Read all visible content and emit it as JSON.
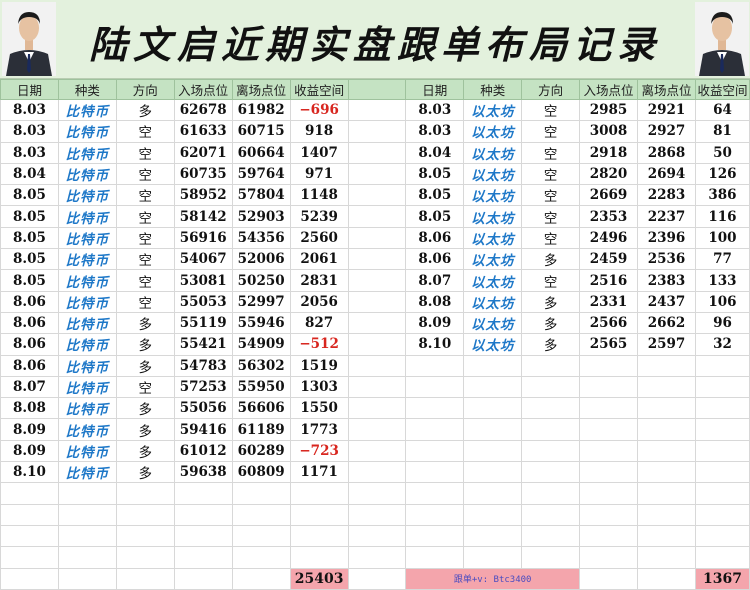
{
  "title": "陆文启近期实盘跟单布局记录",
  "headers": [
    "日期",
    "种类",
    "方向",
    "入场点位",
    "离场点位",
    "收益空间"
  ],
  "left_rows": [
    {
      "date": "8.03",
      "type": "比特币",
      "dir": "多",
      "entry": "62678",
      "exit": "61982",
      "profit": "−696",
      "neg": true
    },
    {
      "date": "8.03",
      "type": "比特币",
      "dir": "空",
      "entry": "61633",
      "exit": "60715",
      "profit": "918"
    },
    {
      "date": "8.03",
      "type": "比特币",
      "dir": "空",
      "entry": "62071",
      "exit": "60664",
      "profit": "1407"
    },
    {
      "date": "8.04",
      "type": "比特币",
      "dir": "空",
      "entry": "60735",
      "exit": "59764",
      "profit": "971"
    },
    {
      "date": "8.05",
      "type": "比特币",
      "dir": "空",
      "entry": "58952",
      "exit": "57804",
      "profit": "1148"
    },
    {
      "date": "8.05",
      "type": "比特币",
      "dir": "空",
      "entry": "58142",
      "exit": "52903",
      "profit": "5239"
    },
    {
      "date": "8.05",
      "type": "比特币",
      "dir": "空",
      "entry": "56916",
      "exit": "54356",
      "profit": "2560"
    },
    {
      "date": "8.05",
      "type": "比特币",
      "dir": "空",
      "entry": "54067",
      "exit": "52006",
      "profit": "2061"
    },
    {
      "date": "8.05",
      "type": "比特币",
      "dir": "空",
      "entry": "53081",
      "exit": "50250",
      "profit": "2831"
    },
    {
      "date": "8.06",
      "type": "比特币",
      "dir": "空",
      "entry": "55053",
      "exit": "52997",
      "profit": "2056"
    },
    {
      "date": "8.06",
      "type": "比特币",
      "dir": "多",
      "entry": "55119",
      "exit": "55946",
      "profit": "827"
    },
    {
      "date": "8.06",
      "type": "比特币",
      "dir": "多",
      "entry": "55421",
      "exit": "54909",
      "profit": "−512",
      "neg": true
    },
    {
      "date": "8.06",
      "type": "比特币",
      "dir": "多",
      "entry": "54783",
      "exit": "56302",
      "profit": "1519"
    },
    {
      "date": "8.07",
      "type": "比特币",
      "dir": "空",
      "entry": "57253",
      "exit": "55950",
      "profit": "1303"
    },
    {
      "date": "8.08",
      "type": "比特币",
      "dir": "多",
      "entry": "55056",
      "exit": "56606",
      "profit": "1550"
    },
    {
      "date": "8.09",
      "type": "比特币",
      "dir": "多",
      "entry": "59416",
      "exit": "61189",
      "profit": "1773"
    },
    {
      "date": "8.09",
      "type": "比特币",
      "dir": "多",
      "entry": "61012",
      "exit": "60289",
      "profit": "−723",
      "neg": true
    },
    {
      "date": "8.10",
      "type": "比特币",
      "dir": "多",
      "entry": "59638",
      "exit": "60809",
      "profit": "1171"
    }
  ],
  "right_rows": [
    {
      "date": "8.03",
      "type": "以太坊",
      "dir": "空",
      "entry": "2985",
      "exit": "2921",
      "profit": "64"
    },
    {
      "date": "8.03",
      "type": "以太坊",
      "dir": "空",
      "entry": "3008",
      "exit": "2927",
      "profit": "81"
    },
    {
      "date": "8.04",
      "type": "以太坊",
      "dir": "空",
      "entry": "2918",
      "exit": "2868",
      "profit": "50"
    },
    {
      "date": "8.05",
      "type": "以太坊",
      "dir": "空",
      "entry": "2820",
      "exit": "2694",
      "profit": "126"
    },
    {
      "date": "8.05",
      "type": "以太坊",
      "dir": "空",
      "entry": "2669",
      "exit": "2283",
      "profit": "386"
    },
    {
      "date": "8.05",
      "type": "以太坊",
      "dir": "空",
      "entry": "2353",
      "exit": "2237",
      "profit": "116"
    },
    {
      "date": "8.06",
      "type": "以太坊",
      "dir": "空",
      "entry": "2496",
      "exit": "2396",
      "profit": "100"
    },
    {
      "date": "8.06",
      "type": "以太坊",
      "dir": "多",
      "entry": "2459",
      "exit": "2536",
      "profit": "77"
    },
    {
      "date": "8.07",
      "type": "以太坊",
      "dir": "空",
      "entry": "2516",
      "exit": "2383",
      "profit": "133"
    },
    {
      "date": "8.08",
      "type": "以太坊",
      "dir": "多",
      "entry": "2331",
      "exit": "2437",
      "profit": "106"
    },
    {
      "date": "8.09",
      "type": "以太坊",
      "dir": "多",
      "entry": "2566",
      "exit": "2662",
      "profit": "96"
    },
    {
      "date": "8.10",
      "type": "以太坊",
      "dir": "多",
      "entry": "2565",
      "exit": "2597",
      "profit": "32"
    }
  ],
  "footer": {
    "left_total": "25403",
    "note": "跟单+v: Btc3400",
    "right_total": "1367"
  },
  "icons": {
    "left_avatar": "person-avatar-icon",
    "right_avatar": "person-avatar-icon"
  },
  "colors": {
    "header_bg": "#c5e3c3",
    "banner_bg": "#e3f1dd",
    "total_bg": "#f4a5ac",
    "negative": "#d8261f",
    "type_text": "#1e78c8"
  }
}
